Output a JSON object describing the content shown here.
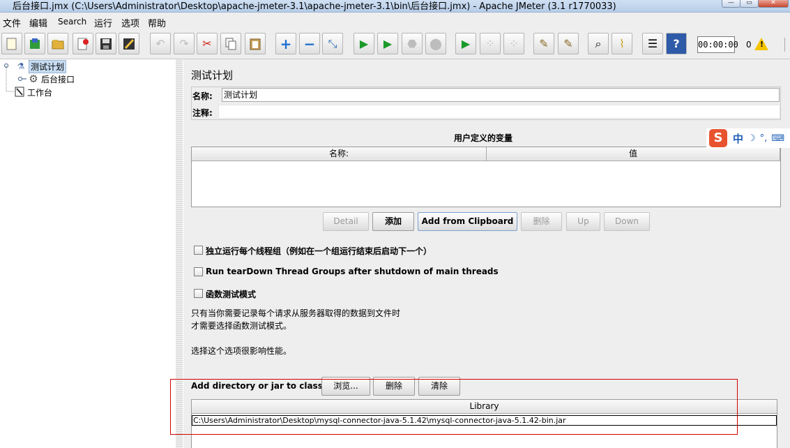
{
  "window": {
    "title": "后台接口.jmx (C:\\Users\\Administrator\\Desktop\\apache-jmeter-3.1\\apache-jmeter-3.1\\bin\\后台接口.jmx) - Apache JMeter (3.1 r1770033)"
  },
  "menu": [
    "文件",
    "编辑",
    "Search",
    "运行",
    "选项",
    "帮助"
  ],
  "toolbar": {
    "timer": "00:00:00",
    "error_count": "0",
    "warning_symbol": "!",
    "icons": [
      "new-icon",
      "templates-icon",
      "open-icon",
      "close-icon",
      "save-icon",
      "save-as-icon",
      "undo-icon",
      "redo-icon",
      "cut-icon",
      "copy-icon",
      "paste-icon",
      "expand-icon",
      "collapse-icon",
      "toggle-icon",
      "start-icon",
      "start-no-pause-icon",
      "stop-icon",
      "shutdown-icon",
      "remote-start-icon",
      "remote-stop-icon",
      "remote-exit-icon",
      "clear-icon",
      "clear-all-icon",
      "search-icon",
      "reset-search-icon",
      "function-helper-icon",
      "help-icon"
    ]
  },
  "tree": {
    "items": [
      {
        "label": "测试计划",
        "icon": "test-plan-icon",
        "selected": true
      },
      {
        "label": "后台接口",
        "icon": "gear-icon",
        "selected": false
      },
      {
        "label": "工作台",
        "icon": "workbench-icon",
        "selected": false
      }
    ]
  },
  "panel": {
    "title": "测试计划",
    "name_label": "名称:",
    "name_value": "测试计划",
    "comment_label": "注释:",
    "comment_value": "",
    "udv_title": "用户定义的变量",
    "udv_columns": [
      "名称:",
      "值"
    ],
    "buttons": [
      {
        "label": "Detail",
        "enabled": false
      },
      {
        "label": "添加",
        "enabled": true
      },
      {
        "label": "Add from Clipboard",
        "enabled": true
      },
      {
        "label": "删除",
        "enabled": false
      },
      {
        "label": "Up",
        "enabled": false
      },
      {
        "label": "Down",
        "enabled": false
      }
    ],
    "checkboxes": [
      {
        "label": "独立运行每个线程组（例如在一个组运行结束后启动下一个）",
        "checked": false
      },
      {
        "label": "Run tearDown Thread Groups after shutdown of main threads",
        "checked": false
      },
      {
        "label": "函数测试模式",
        "checked": false
      }
    ],
    "help_lines": [
      "只有当你需要记录每个请求从服务器取得的数据到文件时",
      "才需要选择函数测试模式。",
      "选择这个选项很影响性能。"
    ],
    "classpath_label": "Add directory or jar to classpath",
    "classpath_buttons": [
      "浏览...",
      "删除",
      "清除"
    ],
    "library_header": "Library",
    "library_rows": [
      "C:\\Users\\Administrator\\Desktop\\mysql-connector-java-5.1.42\\mysql-connector-java-5.1.42-bin.jar"
    ]
  },
  "ime": {
    "logo": "S",
    "mode": "中",
    "moon": "☽",
    "punct": "°,",
    "keyboard": "⌨"
  }
}
